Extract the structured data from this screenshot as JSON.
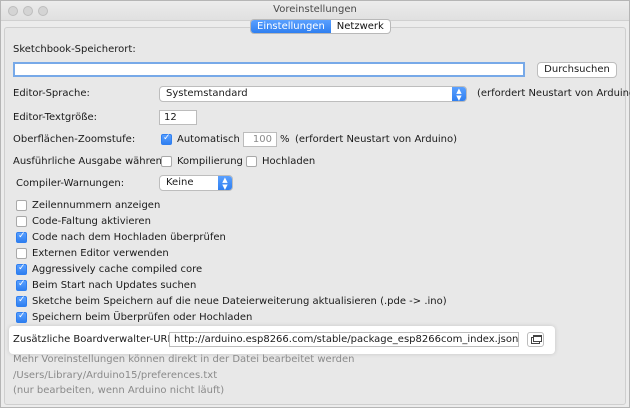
{
  "window": {
    "title": "Voreinstellungen"
  },
  "tabs": [
    {
      "label": "Einstellungen",
      "active": true
    },
    {
      "label": "Netzwerk",
      "active": false
    }
  ],
  "sketchbook": {
    "label": "Sketchbook-Speicherort:",
    "value": "",
    "browse_label": "Durchsuchen"
  },
  "editor_language": {
    "label": "Editor-Sprache:",
    "value": "Systemstandard",
    "note": "(erfordert Neustart von Arduino)"
  },
  "editor_font_size": {
    "label": "Editor-Textgröße:",
    "value": "12"
  },
  "zoom": {
    "label": "Oberflächen-Zoomstufe:",
    "auto_label": "Automatisch",
    "auto_checked": true,
    "value": "100",
    "unit": "%",
    "note": "(erfordert Neustart von Arduino)"
  },
  "verbose": {
    "label": "Ausführliche Ausgabe während:",
    "compile_label": "Kompilierung",
    "compile_checked": false,
    "upload_label": "Hochladen",
    "upload_checked": false
  },
  "compiler_warnings": {
    "label": "Compiler-Warnungen:",
    "value": "Keine"
  },
  "options": [
    {
      "label": "Zeilennummern anzeigen",
      "checked": false
    },
    {
      "label": "Code-Faltung aktivieren",
      "checked": false
    },
    {
      "label": "Code nach dem Hochladen überprüfen",
      "checked": true
    },
    {
      "label": "Externen Editor verwenden",
      "checked": false
    },
    {
      "label": "Aggressively cache compiled core",
      "checked": true
    },
    {
      "label": "Beim Start nach Updates suchen",
      "checked": true
    },
    {
      "label": "Sketche beim Speichern auf die neue Dateierweiterung aktualisieren (.pde -> .ino)",
      "checked": true
    },
    {
      "label": "Speichern beim Überprüfen oder Hochladen",
      "checked": true
    }
  ],
  "board_urls": {
    "label": "Zusätzliche Boardverwalter-URLs:",
    "value": "http://arduino.esp8266.com/stable/package_esp8266com_index.json"
  },
  "footer": {
    "line1": "Mehr Voreinstellungen können direkt in der Datei bearbeitet werden",
    "path": "/Users/Library/Arduino15/preferences.txt",
    "line3": "(nur bearbeiten, wenn Arduino nicht läuft)"
  }
}
